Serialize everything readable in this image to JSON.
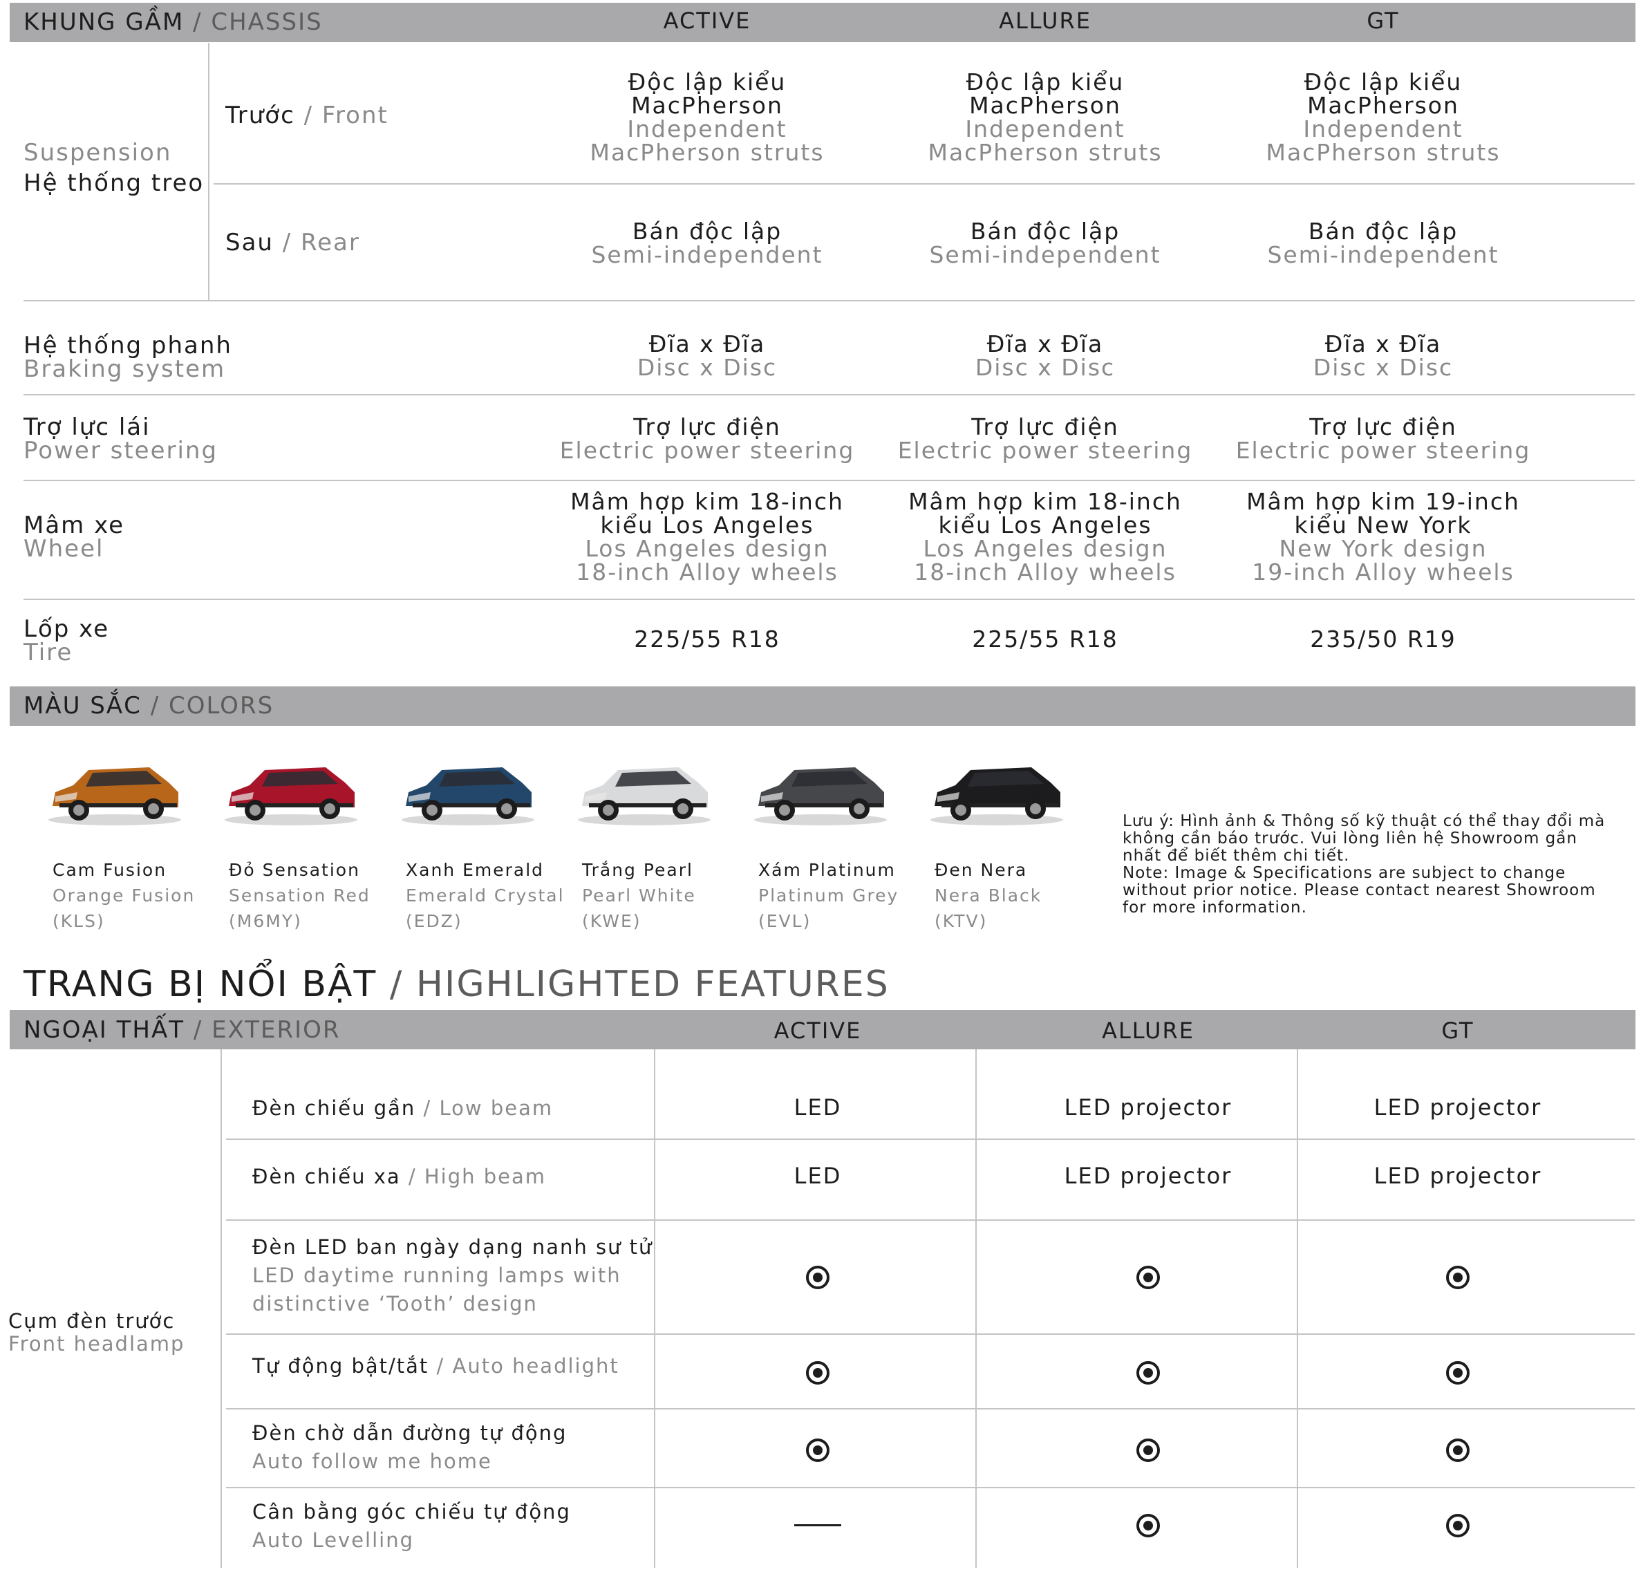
{
  "chassis": {
    "title_vi": "KHUNG GẦM",
    "title_en": "/ CHASSIS",
    "columns": [
      "ACTIVE",
      "ALLURE",
      "GT"
    ],
    "suspension": {
      "label_en": "Suspension",
      "label_vi": "Hệ thống treo",
      "front": {
        "label_vi": "Trước",
        "label_en": "/ Front",
        "values": [
          {
            "vi1": "Độc lập kiểu",
            "vi2": "MacPherson",
            "en1": "Independent",
            "en2": "MacPherson struts"
          },
          {
            "vi1": "Độc lập kiểu",
            "vi2": "MacPherson",
            "en1": "Independent",
            "en2": "MacPherson struts"
          },
          {
            "vi1": "Độc lập kiểu",
            "vi2": "MacPherson",
            "en1": "Independent",
            "en2": "MacPherson struts"
          }
        ]
      },
      "rear": {
        "label_vi": "Sau",
        "label_en": "/ Rear",
        "values": [
          {
            "vi": "Bán độc lập",
            "en": "Semi-independent"
          },
          {
            "vi": "Bán độc lập",
            "en": "Semi-independent"
          },
          {
            "vi": "Bán độc lập",
            "en": "Semi-independent"
          }
        ]
      }
    },
    "braking": {
      "label_vi": "Hệ thống phanh",
      "label_en": "Braking system",
      "values": [
        {
          "vi": "Đĩa x Đĩa",
          "en": "Disc x Disc"
        },
        {
          "vi": "Đĩa x Đĩa",
          "en": "Disc x Disc"
        },
        {
          "vi": "Đĩa x Đĩa",
          "en": "Disc x Disc"
        }
      ]
    },
    "steering": {
      "label_vi": "Trợ lực lái",
      "label_en": "Power steering",
      "values": [
        {
          "vi": "Trợ lực điện",
          "en": "Electric power steering"
        },
        {
          "vi": "Trợ lực điện",
          "en": "Electric power steering"
        },
        {
          "vi": "Trợ lực điện",
          "en": "Electric power steering"
        }
      ]
    },
    "wheel": {
      "label_vi": "Mâm xe",
      "label_en": "Wheel",
      "values": [
        {
          "vi1": "Mâm hợp kim 18-inch",
          "vi2": "kiểu Los Angeles",
          "en1": "Los Angeles design",
          "en2": "18-inch Alloy wheels"
        },
        {
          "vi1": "Mâm hợp kim 18-inch",
          "vi2": "kiểu Los Angeles",
          "en1": "Los Angeles design",
          "en2": "18-inch Alloy wheels"
        },
        {
          "vi1": "Mâm hợp kim 19-inch",
          "vi2": "kiểu New York",
          "en1": "New York design",
          "en2": "19-inch Alloy wheels"
        }
      ]
    },
    "tire": {
      "label_vi": "Lốp xe",
      "label_en": "Tire",
      "values": [
        "225/55 R18",
        "225/55 R18",
        "235/50 R19"
      ]
    }
  },
  "colors": {
    "title_vi": "MÀU SẮC",
    "title_en": "/ COLORS",
    "items": [
      {
        "vi": "Cam Fusion",
        "en": "Orange Fusion",
        "code": "(KLS)",
        "color": "#b8661a"
      },
      {
        "vi": "Đỏ Sensation",
        "en": "Sensation Red",
        "code": "(M6MY)",
        "color": "#a8142a"
      },
      {
        "vi": "Xanh Emerald",
        "en": "Emerald Crystal",
        "code": "(EDZ)",
        "color": "#23476a"
      },
      {
        "vi": "Trắng Pearl",
        "en": "Pearl White",
        "code": "(KWE)",
        "color": "#d9dadc"
      },
      {
        "vi": "Xám Platinum",
        "en": "Platinum Grey",
        "code": "(EVL)",
        "color": "#45474a"
      },
      {
        "vi": "Đen Nera",
        "en": "Nera Black",
        "code": "(KTV)",
        "color": "#1c1c1e"
      }
    ],
    "note_vi": "Lưu ý:  Hình ảnh & Thông số kỹ thuật có thể thay đổi mà không cần báo trước. Vui lòng liên hệ Showroom gần nhất để biết thêm chi tiết.",
    "note_en": "Note: Image & Specifications are subject to change without prior notice. Please contact nearest Showroom for more information."
  },
  "features": {
    "title_vi": "TRANG BỊ NỔI BẬT",
    "title_en": "/ HIGHLIGHTED FEATURES",
    "exterior_vi": "NGOẠI THẤT",
    "exterior_en": "/ EXTERIOR",
    "columns": [
      "ACTIVE",
      "ALLURE",
      "GT"
    ],
    "group_vi": "Cụm đèn trước",
    "group_en": "Front headlamp",
    "rows": [
      {
        "vi": "Đèn chiếu gần",
        "en": "/ Low beam",
        "values": [
          "LED",
          "LED projector",
          "LED projector"
        ]
      },
      {
        "vi": "Đèn chiếu xa",
        "en": "/ High beam",
        "values": [
          "LED",
          "LED projector",
          "LED projector"
        ]
      },
      {
        "vi": "Đèn LED ban ngày dạng nanh sư tử",
        "en1": "LED daytime running lamps with",
        "en2": "distinctive ‘Tooth’ design",
        "marks": [
          "dot",
          "dot",
          "dot"
        ]
      },
      {
        "vi": "Tự động bật/tắt",
        "en": "/ Auto headlight",
        "marks": [
          "dot",
          "dot",
          "dot"
        ]
      },
      {
        "vi": "Đèn chờ dẫn đường tự động",
        "en2": "Auto follow me home",
        "marks": [
          "dot",
          "dot",
          "dot"
        ]
      },
      {
        "vi": "Cân bằng góc chiếu tự động",
        "en2": "Auto Levelling",
        "marks": [
          "dash",
          "dot",
          "dot"
        ]
      }
    ]
  }
}
